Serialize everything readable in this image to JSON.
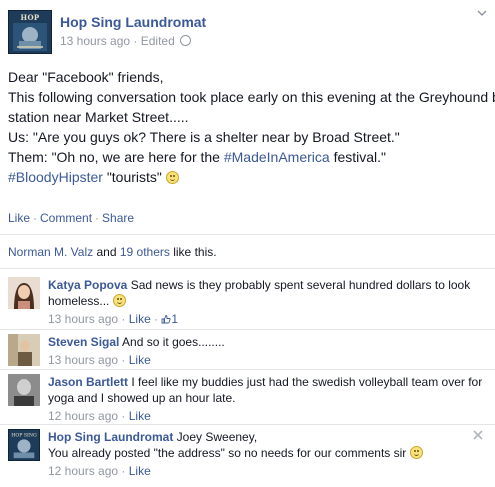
{
  "post": {
    "author": "Hop Sing Laundromat",
    "time": "13 hours ago",
    "edited": "Edited",
    "avatar_text": "HOP SING",
    "lines": [
      "Dear \"Facebook\" friends,",
      "This following conversation took place early on this evening at the Greyhound bus",
      "station near Market Street.....",
      "Us: \"Are you guys ok? There is a shelter near by Broad Street.\"",
      "Them: \"Oh no, we are here for the "
    ],
    "hashtag_madeinamerica": "#MadeInAmerica",
    "line5_tail": " festival.\"",
    "hashtag_bloodyhipster": "#BloodyHipster",
    "line6_tail": " \"tourists\" "
  },
  "actions": {
    "like": "Like",
    "comment": "Comment",
    "share": "Share",
    "sep": "·"
  },
  "likes": {
    "name": "Norman M. Valz",
    "and": " and ",
    "others": "19 others",
    "tail": " like this."
  },
  "comments": [
    {
      "name": "Katya Popova",
      "line1": " Sad news is they probably spent several hundred dollars to look",
      "line2": "homeless... ",
      "time": "13 hours ago",
      "like": "Like",
      "like_count": "1"
    },
    {
      "name": "Steven Sigal",
      "line1": " And so it goes........",
      "time": "13 hours ago",
      "like": "Like"
    },
    {
      "name": "Jason Bartlett",
      "line1": " I feel like my buddies just had the swedish volleyball team over for",
      "line2": "yoga and I showed up an hour late.",
      "time": "12 hours ago",
      "like": "Like"
    },
    {
      "name": "Hop Sing Laundromat",
      "line1": " Joey Sweeney,",
      "line2": "You already posted \"the address\" so no needs for our comments sir ",
      "time": "12 hours ago",
      "like": "Like",
      "avatar_text": "HOP SING"
    }
  ],
  "colors": {
    "link": "#3b5998",
    "meta": "#9197a3",
    "text": "#141823",
    "divider": "#e5e5e5"
  }
}
